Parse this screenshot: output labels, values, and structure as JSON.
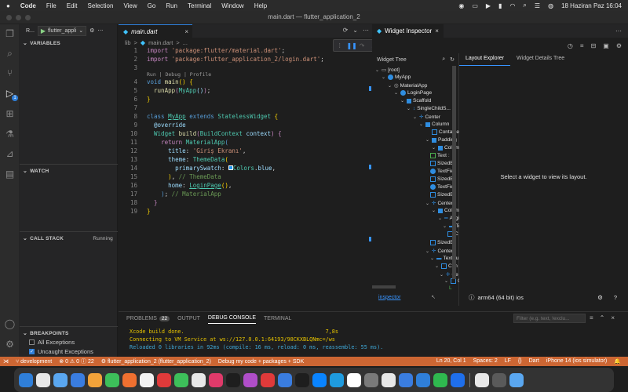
{
  "menubar": {
    "apple": "",
    "app_name": "Code",
    "items": [
      "File",
      "Edit",
      "Selection",
      "View",
      "Go",
      "Run",
      "Terminal",
      "Window",
      "Help"
    ],
    "datetime": "18 Haziran Paz  16:04"
  },
  "window": {
    "title": "main.dart — flutter_application_2"
  },
  "sidebar": {
    "run_label": "R...",
    "run_config": "flutter_appli",
    "variables_header": "VARIABLES",
    "watch_header": "WATCH",
    "callstack_header": "CALL STACK",
    "callstack_status": "Running",
    "breakpoints_header": "BREAKPOINTS",
    "breakpoints": [
      {
        "label": "All Exceptions",
        "checked": false
      },
      {
        "label": "Uncaught Exceptions",
        "checked": true
      }
    ]
  },
  "activity_badge": "1",
  "editor": {
    "tab_label": "main.dart",
    "breadcrumb": [
      "lib",
      ">",
      "main.dart",
      ">",
      "..."
    ],
    "codelens": "Run | Debug | Profile",
    "line_numbers": [
      "1",
      "2",
      "3",
      "4",
      "5",
      "6",
      "7",
      "8",
      "9",
      "10",
      "11",
      "12",
      "13",
      "14",
      "15",
      "16",
      "17",
      "18",
      "19"
    ]
  },
  "widget_inspector": {
    "tab_label": "Widget Inspector",
    "tree_header": "Widget Tree",
    "tree": [
      "[root]",
      "MyApp",
      "MaterialApp",
      "LoginPage",
      "Scaffold",
      "SingleChildS...",
      "Center",
      "Column",
      "Container",
      "Padding",
      "Column",
      "Text",
      "SizedBo",
      "TextFiel",
      "SizedBo",
      "TextFiel",
      "SizedBo",
      "Center",
      "Colum",
      "Aligi",
      "Tex",
      "C",
      "SizedBo",
      "Center",
      "TextBu",
      "Con",
      "Ce",
      "C",
      "L"
    ],
    "footer_link": "inspector",
    "layout_tabs": [
      "Layout Explorer",
      "Widget Details Tree"
    ],
    "layout_message": "Select a widget to view its layout.",
    "device": "arm64 (64 bit) ios"
  },
  "panel": {
    "tabs": [
      "PROBLEMS",
      "OUTPUT",
      "DEBUG CONSOLE",
      "TERMINAL"
    ],
    "problems_count": "22",
    "filter_placeholder": "Filter (e.g. text, !exclu...",
    "console": [
      {
        "text": "Xcode build done.                                            7,8s",
        "color": "#e6c300"
      },
      {
        "text": "Connecting to VM Service at ws://127.0.0.1:64193/98CKXBLQNmc=/ws",
        "color": "#e6c300"
      },
      {
        "text": "Reloaded 0 libraries in 92ms (compile: 16 ms, reload: 0 ms, reassemble: 55 ms).",
        "color": "#3fa7d6"
      }
    ]
  },
  "statusbar": {
    "branch": "development",
    "errors": "0",
    "warnings": "0",
    "infos": "22",
    "app": "flutter_application_2 (flutter_application_2)",
    "debug_mode": "Debug my code + packages + SDK",
    "position": "Ln 20, Col 1",
    "spaces": "Spaces: 2",
    "eol": "LF",
    "language": "Dart",
    "device": "iPhone 14 (ios simulator)"
  },
  "dock": {
    "apps": [
      "#2f7fd9",
      "#e8e8e8",
      "#5aa7f0",
      "#3a7de0",
      "#f2a33a",
      "#3dbf5a",
      "#f07030",
      "#f2f2f2",
      "#e03a3a",
      "#3dbf5a",
      "#e8e8e8",
      "#e03a6a",
      "#1e1e1e",
      "#b04ec9",
      "#e03a3a",
      "#3a7de0",
      "#1e1e1e",
      "#0a84ff",
      "#1f9bde",
      "#ffffff",
      "#7a7a7a",
      "#e8e8e8",
      "#3a7de0",
      "#2f7fd9",
      "#2fb84f",
      "#1f6feb",
      "#e8e8e8",
      "#5a5a5a",
      "#5aa7f0"
    ]
  }
}
